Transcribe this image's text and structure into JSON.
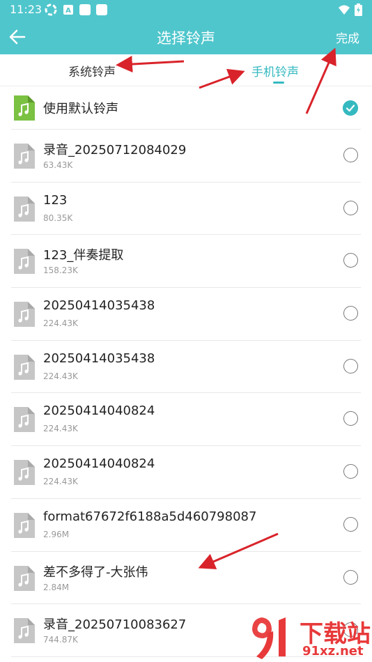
{
  "status": {
    "time": "11:23"
  },
  "appbar": {
    "title": "选择铃声",
    "done_label": "完成"
  },
  "tabs": [
    {
      "label": "系统铃声",
      "active": false
    },
    {
      "label": "手机铃声",
      "active": true
    }
  ],
  "default_item": {
    "label": "使用默认铃声",
    "selected": true
  },
  "items": [
    {
      "name": "录音_20250712084029",
      "size": "63.43K"
    },
    {
      "name": "123",
      "size": "80.35K"
    },
    {
      "name": "123_伴奏提取",
      "size": "158.23K"
    },
    {
      "name": "20250414035438",
      "size": "224.43K"
    },
    {
      "name": "20250414035438",
      "size": "224.43K"
    },
    {
      "name": "20250414040824",
      "size": "224.43K"
    },
    {
      "name": "20250414040824",
      "size": "224.43K"
    },
    {
      "name": "format67672f6188a5d460798087",
      "size": "2.96M"
    },
    {
      "name": "差不多得了-大张伟",
      "size": "2.84M"
    },
    {
      "name": "录音_20250710083627",
      "size": "744.87K"
    }
  ],
  "watermark": {
    "line1": "下载站",
    "line2": "91xz.net"
  },
  "colors": {
    "accent": "#4fc6cc",
    "selected": "#35b9c0",
    "arrow": "#d9232a",
    "default_icon": "#7bc142"
  }
}
